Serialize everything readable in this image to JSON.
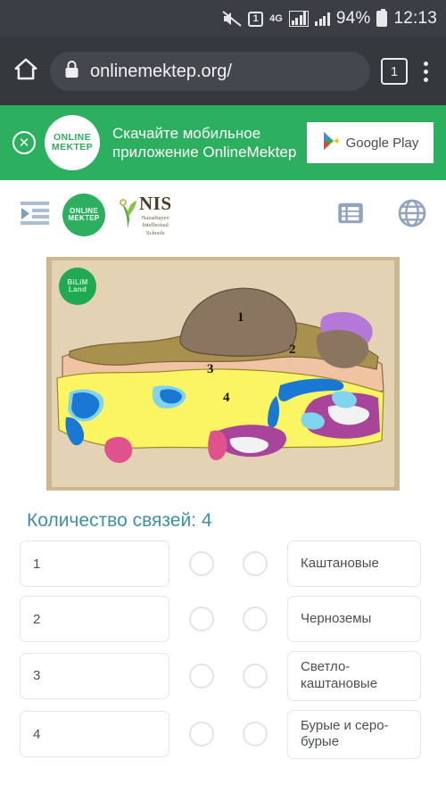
{
  "statusbar": {
    "mute_icon": "mute-icon",
    "sim_badge": "1",
    "network": "4G",
    "battery_percent": "94%",
    "time": "12:13"
  },
  "browser": {
    "home_icon": "home-icon",
    "lock_icon": "lock-icon",
    "url": "onlinemektep.org/",
    "tab_count": "1",
    "menu_icon": "overflow-menu-icon"
  },
  "promo": {
    "close_label": "✕",
    "logo_line1": "ONLINE",
    "logo_line2": "MEKTEP",
    "text": "Скачайте мобильное приложение OnlineMektep",
    "store_button": "Google Play"
  },
  "header": {
    "menu_icon": "sidebar-toggle-icon",
    "logo_line1": "ONLINE",
    "logo_line2": "MEKTEP",
    "nis_word": "NIS",
    "nis_sub_line1": "Nazarbayev",
    "nis_sub_line2": "Intellectual",
    "nis_sub_line3": "Schools",
    "list_icon": "list-icon",
    "globe_icon": "globe-icon"
  },
  "map": {
    "watermark_line1": "BiLiM",
    "watermark_line2": "Land",
    "labels": [
      "1",
      "2",
      "3",
      "4"
    ],
    "colors": {
      "background": "#cdb692",
      "zone1_chernozem": "#8a7560",
      "zone2_chestnut": "#a8914f",
      "zone3_light_chestnut": "#f0c3a3",
      "zone4_brown_desert": "#fbf563",
      "mountains_purple": "#a8449a",
      "mountains_violet": "#b478d9",
      "water_blue": "#1878d4",
      "water_light": "#7fd4f0",
      "pink_zone": "#e0528c",
      "snow_white": "#f2f2f2"
    }
  },
  "question": {
    "title": "Количество связей: 4",
    "left_items": [
      "1",
      "2",
      "3",
      "4"
    ],
    "right_items": [
      "Каштановые",
      "Черноземы",
      "Светло-каштановые",
      "Бурые и серо-бурые"
    ],
    "connector_state": "empty"
  }
}
